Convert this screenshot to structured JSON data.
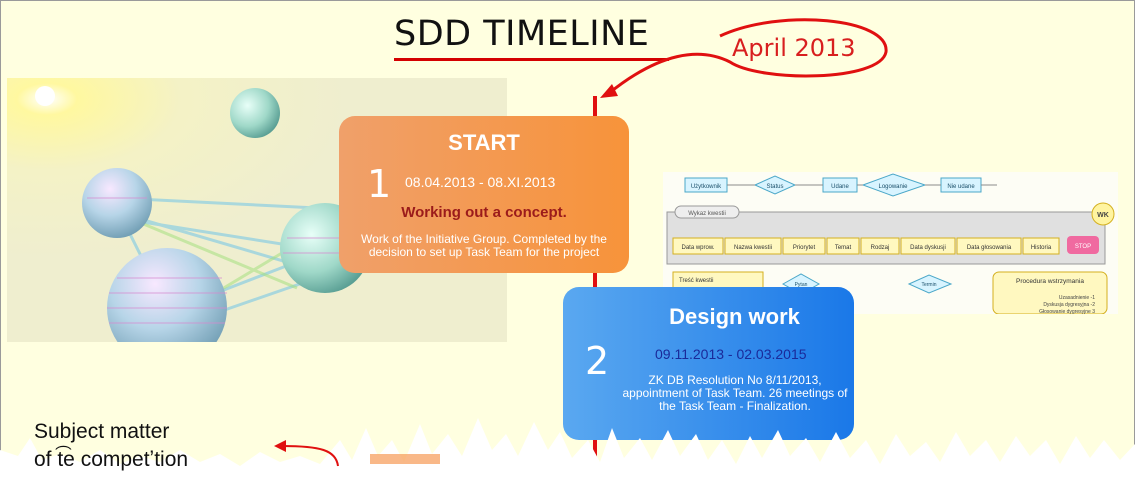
{
  "header": {
    "title": "SDD TIMELINE",
    "date_callout": "April 2013"
  },
  "cards": [
    {
      "number": "1",
      "title": "START",
      "dates": "08.04.2013 - 08.XI.2013",
      "subtitle": "Working out a concept.",
      "description": "Work of the Initiative Group. Completed by the decision to set up Task Team for the project"
    },
    {
      "number": "2",
      "title": "Design work",
      "dates": "09.11.2013 - 02.03.2015",
      "description": "ZK DB Resolution No 8/11/2013, appointment of Task Team. 26 meetings of the Task Team - Finalization."
    }
  ],
  "diagram": {
    "nodes_top": [
      "Użytkownik",
      "Status",
      "Udane",
      "Logowanie",
      "Nie udane"
    ],
    "group_label": "Wykaz kwestii",
    "badge": "WK",
    "columns": [
      "Data wprow.",
      "Nazwa kwestii",
      "Priorytet",
      "Temat",
      "Rodzaj",
      "Data dyskusji",
      "Data głosowania",
      "Historia"
    ],
    "stop": "STOP",
    "bottom_left": "Treść kwestii",
    "bottom_mid1": "Pytan",
    "bottom_mid2": "Termin",
    "bottom_right_title": "Procedura wstrzymania",
    "bottom_right_lines": [
      "Uzasadnienie -1",
      "Dyskusja dygresyjna -2",
      "Głosowanie dygresyjne 3"
    ]
  },
  "footer": {
    "subject_line1": "Subject matter",
    "subject_line2": "of t͡e competʼtion"
  },
  "colors": {
    "background": "#ffffe0",
    "accent_red": "#e01010",
    "start_card": "#f7933a",
    "design_card": "#1a78e8",
    "subtitle_red": "#9b1b1b",
    "date_blue": "#1a2a9a"
  }
}
